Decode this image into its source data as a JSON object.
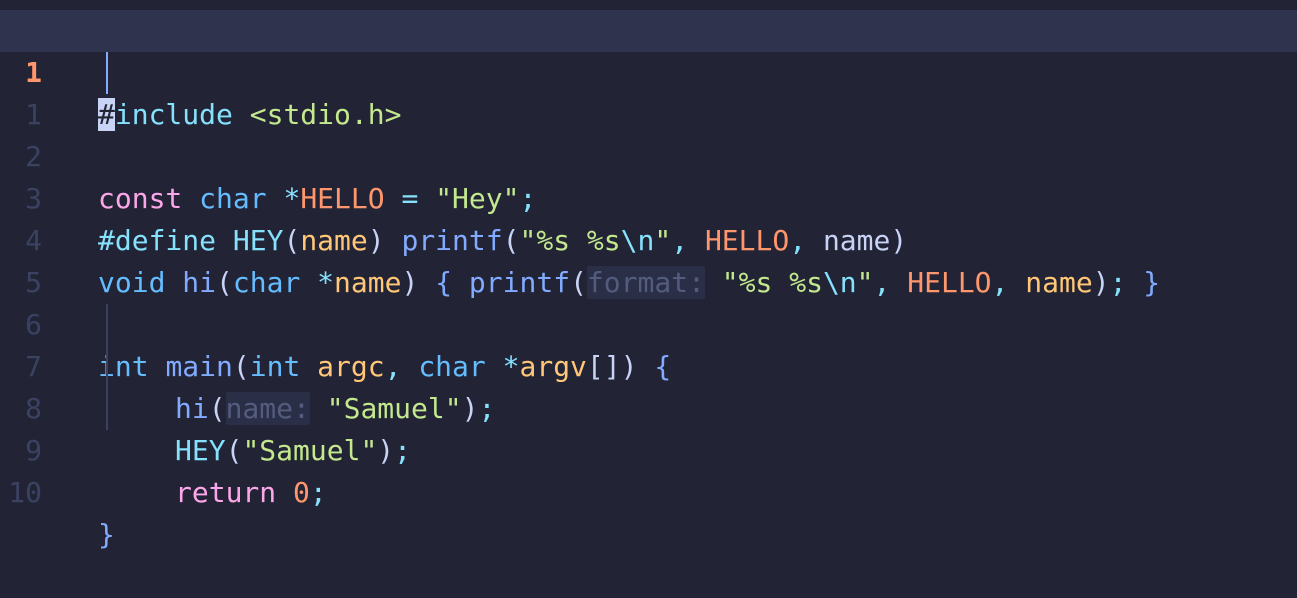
{
  "gutter": [
    "1",
    "1",
    "2",
    "3",
    "4",
    "5",
    "6",
    "7",
    "8",
    "9",
    "10"
  ],
  "code": {
    "l0": {
      "hash": "#",
      "include": "include",
      "header": "<stdio.h>"
    },
    "l2": {
      "const": "const",
      "char": "char",
      "star": "*",
      "name": "HELLO",
      "eq": "=",
      "str": "\"Hey\"",
      "semi": ";"
    },
    "l3": {
      "define": "#define",
      "macro": "HEY",
      "lp": "(",
      "param": "name",
      "rp": ")",
      "printf": "printf",
      "lp2": "(",
      "s1": "\"%s %s",
      "esc": "\\n",
      "s2": "\"",
      "c1": ",",
      "hello": "HELLO",
      "c2": ",",
      "name": "name",
      "rp2": ")"
    },
    "l4": {
      "void": "void",
      "fn": "hi",
      "lp": "(",
      "char": "char",
      "star": "*",
      "param": "name",
      "rp": ")",
      "lb": "{",
      "printf": "printf",
      "lp2": "(",
      "hint": "format:",
      "s1": "\"%s %s",
      "esc": "\\n",
      "s2": "\"",
      "c1": ",",
      "hello": "HELLO",
      "c2": ",",
      "name": "name",
      "rp2": ")",
      "semi": ";",
      "rb": "}"
    },
    "l6": {
      "int": "int",
      "main": "main",
      "lp": "(",
      "int2": "int",
      "argc": "argc",
      "c1": ",",
      "char": "char",
      "star": "*",
      "argv": "argv",
      "br": "[]",
      "rp": ")",
      "lb": "{"
    },
    "l7": {
      "fn": "hi",
      "lp": "(",
      "hint": "name:",
      "str": "\"Samuel\"",
      "rp": ")",
      "semi": ";"
    },
    "l8": {
      "macro": "HEY",
      "lp": "(",
      "str": "\"Samuel\"",
      "rp": ")",
      "semi": ";"
    },
    "l9": {
      "ret": "return",
      "num": "0",
      "semi": ";"
    },
    "l10": {
      "rb": "}"
    }
  }
}
